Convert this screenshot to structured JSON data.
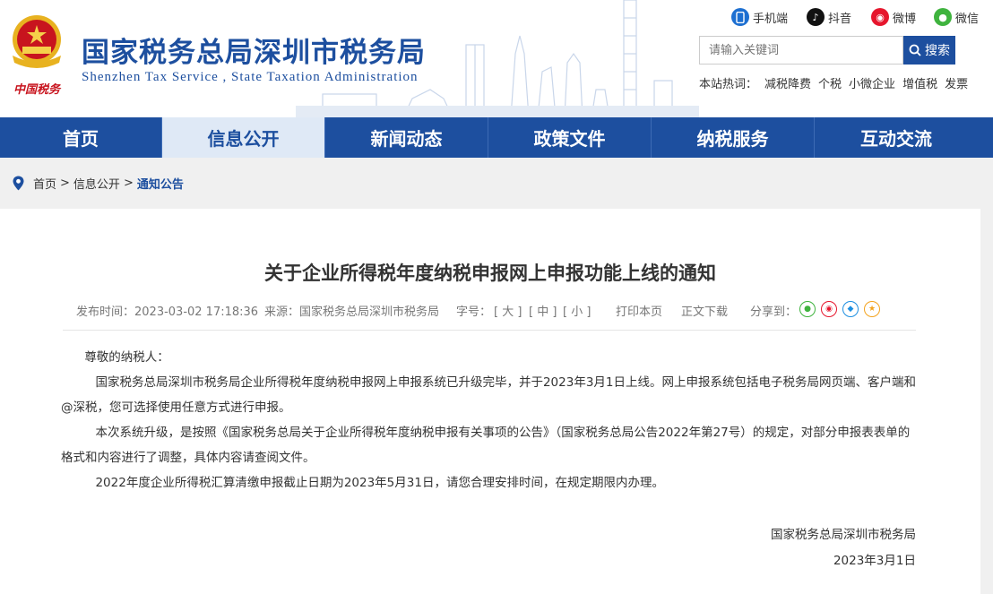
{
  "header": {
    "title": "国家税务总局深圳市税务局",
    "subtitle": "Shenzhen Tax Service , State Taxation Administration",
    "emblem_text": "中国税务",
    "social": [
      {
        "label": "手机端",
        "icon": "mobile-icon",
        "color": "#1d6fd1"
      },
      {
        "label": "抖音",
        "icon": "douyin-icon",
        "color": "#111111"
      },
      {
        "label": "微博",
        "icon": "weibo-icon",
        "color": "#e6162d"
      },
      {
        "label": "微信",
        "icon": "wechat-icon",
        "color": "#3fb33e"
      }
    ],
    "search": {
      "placeholder": "请输入关键词",
      "button": "搜索"
    },
    "hot": {
      "label": "本站热词：",
      "keywords": [
        "减税降费",
        "个税",
        "小微企业",
        "增值税",
        "发票"
      ]
    }
  },
  "nav": {
    "items": [
      "首页",
      "信息公开",
      "新闻动态",
      "政策文件",
      "纳税服务",
      "互动交流"
    ],
    "active_index": 1
  },
  "breadcrumb": {
    "home": "首页",
    "sep": ">",
    "level1": "信息公开",
    "current": "通知公告"
  },
  "article": {
    "title": "关于企业所得税年度纳税申报网上申报功能上线的通知",
    "meta": {
      "publish_time": "发布时间：2023-03-02 17:18:36",
      "source": "来源：国家税务总局深圳市税务局",
      "font_size_label": "字号：",
      "font_large": "[ 大 ]",
      "font_medium": "[ 中 ]",
      "font_small": "[ 小 ]",
      "print": "打印本页",
      "download": "正文下载",
      "share_label": "分享到："
    },
    "share": [
      {
        "icon": "wechat-share-icon",
        "color": "#3fb33e"
      },
      {
        "icon": "weibo-share-icon",
        "color": "#e6162d"
      },
      {
        "icon": "qq-share-icon",
        "color": "#1d8fe1"
      },
      {
        "icon": "qzone-share-icon",
        "color": "#f3a31e"
      }
    ],
    "greeting": "尊敬的纳税人：",
    "paragraphs": [
      "国家税务总局深圳市税务局企业所得税年度纳税申报网上申报系统已升级完毕，并于2023年3月1日上线。网上申报系统包括电子税务局网页端、客户端和@深税，您可选择使用任意方式进行申报。",
      "本次系统升级，是按照《国家税务总局关于企业所得税年度纳税申报有关事项的公告》（国家税务总局公告2022年第27号）的规定，对部分申报表表单的格式和内容进行了调整，具体内容请查阅文件。",
      "2022年度企业所得税汇算清缴申报截止日期为2023年5月31日，请您合理安排时间，在规定期限内办理。"
    ],
    "signature": "国家税务总局深圳市税务局",
    "date": "2023年3月1日"
  }
}
